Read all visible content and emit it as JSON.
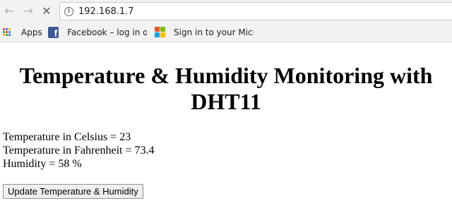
{
  "browser": {
    "url": "192.168.1.7",
    "back_icon": "back-arrow-icon",
    "forward_icon": "forward-arrow-icon",
    "stop_icon": "close-x-icon",
    "info_icon": "info-circle-icon"
  },
  "bookmarks": [
    {
      "label": "Apps",
      "icon": "apps-grid-icon"
    },
    {
      "label": "Facebook – log in or",
      "icon": "facebook-icon"
    },
    {
      "label": "Sign in to your Micro",
      "icon": "microsoft-icon"
    }
  ],
  "page": {
    "title": "Temperature & Humidity Monitoring with DHT11",
    "readings": [
      "Temperature in Celsius = 23",
      "Temperature in Fahrenheit = 73.4",
      "Humidity = 58 %"
    ],
    "button_label": "Update Temperature & Humidity"
  },
  "colors": {
    "facebook": "#3b5998",
    "ms_red": "#f25022",
    "ms_green": "#7fba00",
    "ms_blue": "#00a4ef",
    "ms_yellow": "#ffb900"
  }
}
